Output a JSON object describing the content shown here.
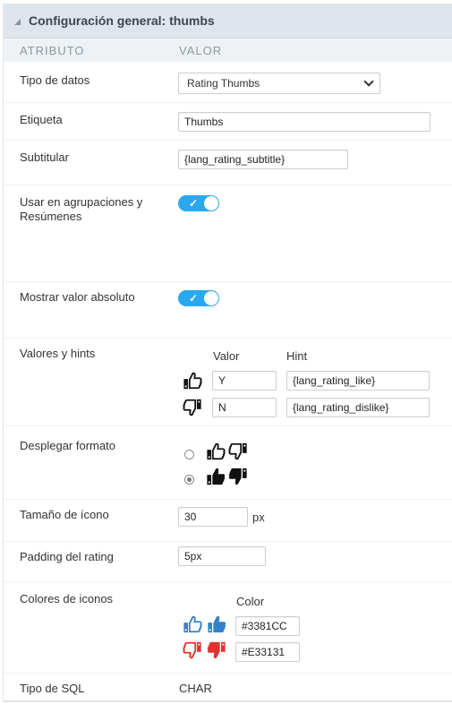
{
  "header": {
    "title": "Configuración general: thumbs",
    "collapse_icon": "triangle-collapse-icon"
  },
  "columns": {
    "attribute": "ATRIBUTO",
    "value": "VALOR"
  },
  "fields": {
    "data_type": {
      "label": "Tipo de datos",
      "value": "Rating Thumbs"
    },
    "label": {
      "label": "Etiqueta",
      "value": "Thumbs"
    },
    "subtitle": {
      "label": "Subtitular",
      "value": "{lang_rating_subtitle}"
    },
    "use_in_groups": {
      "label": "Usar en agrupaciones y Resúmenes",
      "checked": true
    },
    "show_absolute": {
      "label": "Mostrar valor absoluto",
      "checked": true
    },
    "values_hints": {
      "label": "Valores y hints",
      "value_header": "Valor",
      "hint_header": "Hint",
      "rows": [
        {
          "icon": "thumbs-up-outline-icon",
          "value": "Y",
          "hint": "{lang_rating_like}"
        },
        {
          "icon": "thumbs-down-outline-icon",
          "value": "N",
          "hint": "{lang_rating_dislike}"
        }
      ]
    },
    "display_format": {
      "label": "Desplegar formato",
      "options": [
        {
          "name": "outline",
          "selected": false
        },
        {
          "name": "solid",
          "selected": true
        }
      ]
    },
    "icon_size": {
      "label": "Tamaño de ícono",
      "value": "30",
      "unit": "px"
    },
    "padding": {
      "label": "Padding del rating",
      "value": "5px"
    },
    "icon_colors": {
      "label": "Colores de iconos",
      "color_header": "Color",
      "like_color": "#3381CC",
      "dislike_color": "#E33131"
    },
    "sql_type": {
      "label": "Tipo de SQL",
      "value": "CHAR"
    }
  }
}
